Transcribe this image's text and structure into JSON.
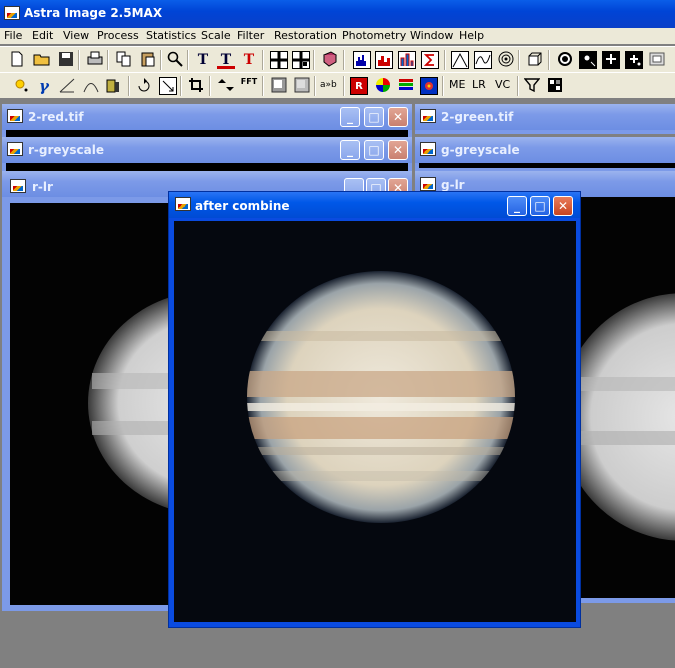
{
  "app": {
    "title": "Astra Image 2.5MAX",
    "icon": "astra-image-app-icon"
  },
  "menu": [
    {
      "label": "File"
    },
    {
      "label": "Edit"
    },
    {
      "label": "View"
    },
    {
      "label": "Process"
    },
    {
      "label": "Statistics"
    },
    {
      "label": "Scale"
    },
    {
      "label": "Filter"
    },
    {
      "label": "Restoration"
    },
    {
      "label": "Photometry"
    },
    {
      "label": "Window"
    },
    {
      "label": "Help"
    }
  ],
  "toolbar": {
    "row2_text": {
      "ab": "a»b",
      "fft": "FFT",
      "me": "ME",
      "lr": "LR",
      "vc": "VC"
    }
  },
  "windows": {
    "red": {
      "title": "2-red.tif"
    },
    "green": {
      "title": "2-green.tif"
    },
    "r_grey": {
      "title": "r-greyscale"
    },
    "g_grey": {
      "title": "g-greyscale"
    },
    "r_lr": {
      "title": "r-lr"
    },
    "g_lr": {
      "title": "g-lr"
    },
    "combine": {
      "title": "after combine"
    }
  },
  "colors": {
    "active_title": "#0058e8",
    "inactive_title": "#7c9ae8",
    "close_button": "#c9441f",
    "mdi_background": "#808080",
    "chrome": "#ece9d8"
  }
}
